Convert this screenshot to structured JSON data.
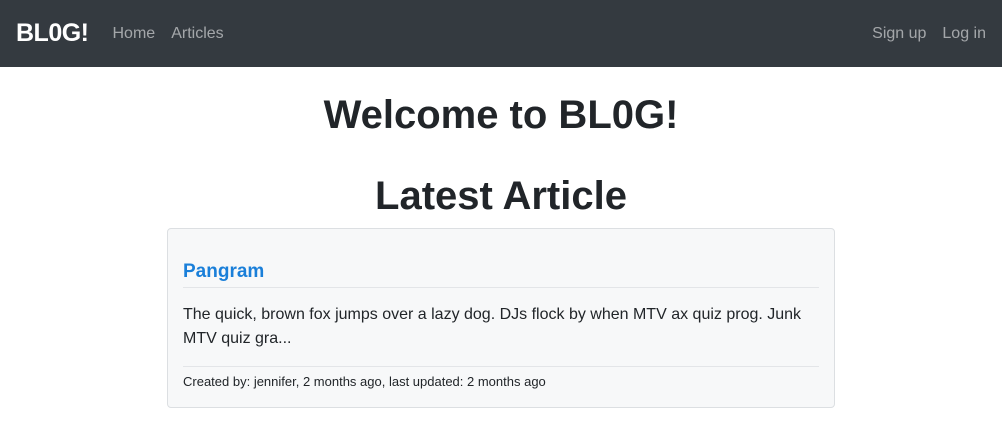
{
  "nav": {
    "brand": "BL0G!",
    "links": [
      "Home",
      "Articles"
    ],
    "right_links": [
      "Sign up",
      "Log in"
    ]
  },
  "main": {
    "welcome_title": "Welcome to BL0G!",
    "latest_title": "Latest Article"
  },
  "article": {
    "title": "Pangram",
    "excerpt": "The quick, brown fox jumps over a lazy dog. DJs flock by when MTV ax quiz prog. Junk MTV quiz gra...",
    "meta": "Created by: jennifer, 2 months ago, last updated: 2 months ago"
  },
  "colors": {
    "navbar_bg": "#343a40",
    "link_blue": "#1a7fd9"
  }
}
